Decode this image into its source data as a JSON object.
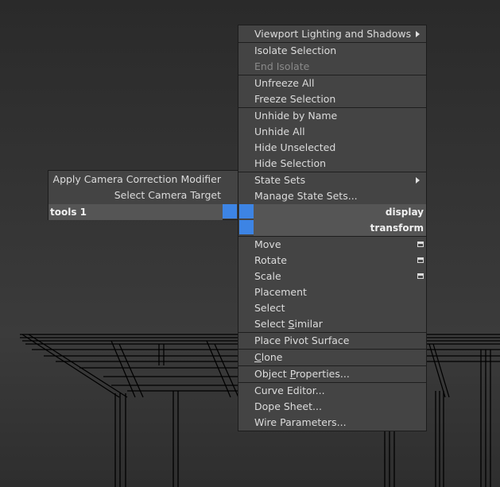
{
  "display_menu": {
    "title": "display",
    "items": [
      {
        "label": "Viewport Lighting and Shadows",
        "submenu": true,
        "sep_before": false
      },
      {
        "label": "Isolate Selection",
        "sep_before": true
      },
      {
        "label": "End Isolate",
        "disabled": true
      },
      {
        "label": "Unfreeze All",
        "sep_before": true
      },
      {
        "label": "Freeze Selection"
      },
      {
        "label": "Unhide by Name",
        "sep_before": true
      },
      {
        "label": "Unhide All"
      },
      {
        "label": "Hide Unselected"
      },
      {
        "label": "Hide Selection"
      },
      {
        "label": "State Sets",
        "submenu": true,
        "sep_before": true
      },
      {
        "label": "Manage State Sets..."
      }
    ]
  },
  "transform_menu": {
    "title": "transform",
    "items": [
      {
        "label": "Move",
        "option_box": true
      },
      {
        "label": "Rotate",
        "option_box": true
      },
      {
        "label": "Scale",
        "option_box": true
      },
      {
        "label": "Placement"
      },
      {
        "label": "Select"
      },
      {
        "label_parts": [
          "Select ",
          "S",
          "imilar"
        ]
      },
      {
        "label": "Place Pivot Surface",
        "sep_before": true
      },
      {
        "label_parts": [
          "",
          "C",
          "lone"
        ],
        "sep_before": true
      },
      {
        "label_parts": [
          "Object ",
          "P",
          "roperties..."
        ],
        "sep_before": true
      },
      {
        "label": "Curve Editor...",
        "sep_before": true
      },
      {
        "label": "Dope Sheet..."
      },
      {
        "label": "Wire Parameters..."
      }
    ]
  },
  "tools_menu": {
    "title": "tools 1",
    "items": [
      {
        "label": "Apply Camera Correction Modifier"
      },
      {
        "label": "Select Camera Target"
      }
    ]
  },
  "colors": {
    "menu_bg": "#444444",
    "header_bg": "#555555",
    "accent_blue": "#3d84e4",
    "text": "#dcdcdc",
    "disabled_text": "#8a8a8a"
  }
}
